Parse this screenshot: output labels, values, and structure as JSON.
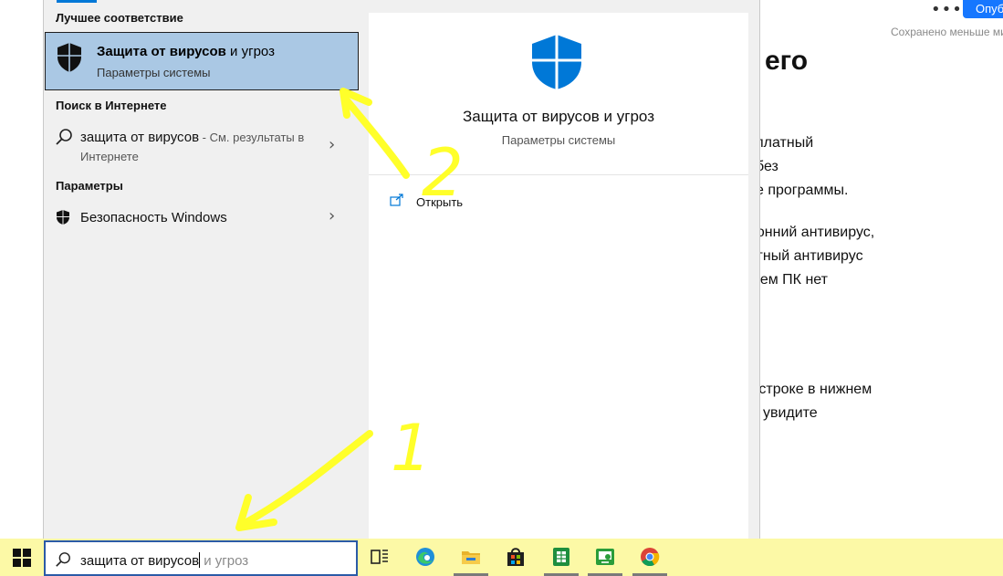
{
  "article": {
    "more": "•••",
    "publish": "Опуб",
    "saved": "Сохранено меньше ми",
    "heading": "его",
    "lines": [
      "платный",
      "без",
      "е программы.",
      "ронний антивирус,",
      "отный антивирус",
      "шем ПК нет",
      "й строке в нижнем",
      "ы увидите"
    ]
  },
  "left": {
    "best_match_title": "Лучшее соответствие",
    "best_match": {
      "title_bold": "Защита от вирусов",
      "title_rest": " и угроз",
      "subtitle": "Параметры системы"
    },
    "web_title": "Поиск в Интернете",
    "web_result": {
      "query": "защита от вирусов",
      "suffix": " - См. результаты в",
      "suffix2": "Интернете"
    },
    "settings_title": "Параметры",
    "settings_item": "Безопасность Windows"
  },
  "preview": {
    "title": "Защита от вирусов и угроз",
    "subtitle": "Параметры системы",
    "open_label": "Открыть"
  },
  "taskbar": {
    "search_typed": "защита от вирусов",
    "search_ghost": "и угроз"
  },
  "annotations": {
    "step1": "1",
    "step2": "2",
    "color": "#ffff2a"
  },
  "colors": {
    "accent": "#0078d7",
    "selection": "#aac8e4",
    "taskbar": "#fcf9a6"
  }
}
